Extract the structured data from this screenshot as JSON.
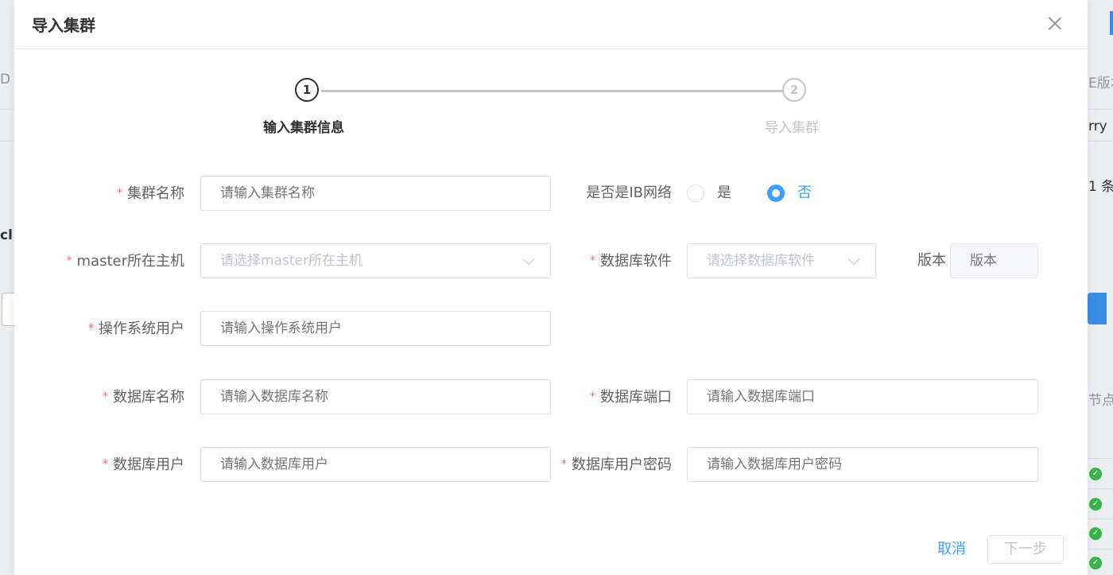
{
  "background": {
    "left_texts": [
      "D",
      "cl"
    ],
    "right_texts": [
      "E版本",
      "rry 1",
      "1 条",
      "节点数",
      "U",
      "U",
      "U",
      "U"
    ]
  },
  "modal": {
    "title": "导入集群",
    "steps": [
      {
        "number": "1",
        "title": "输入集群信息",
        "status": "active"
      },
      {
        "number": "2",
        "title": "导入集群",
        "status": "wait"
      }
    ],
    "form": {
      "required_mark": "*",
      "cluster_name": {
        "label": "集群名称",
        "placeholder": "请输入集群名称",
        "value": ""
      },
      "ib_network": {
        "label": "是否是IB网络",
        "options": [
          {
            "label": "是",
            "checked": false
          },
          {
            "label": "否",
            "checked": true
          }
        ]
      },
      "master_host": {
        "label": "master所在主机",
        "placeholder": "请选择master所在主机",
        "value": ""
      },
      "db_software": {
        "label": "数据库软件",
        "placeholder": "请选择数据库软件",
        "value": ""
      },
      "version": {
        "label": "版本",
        "placeholder": "版本",
        "value": ""
      },
      "os_user": {
        "label": "操作系统用户",
        "placeholder": "请输入操作系统用户",
        "value": ""
      },
      "db_name": {
        "label": "数据库名称",
        "placeholder": "请输入数据库名称",
        "value": ""
      },
      "db_port": {
        "label": "数据库端口",
        "placeholder": "请输入数据库端口",
        "value": ""
      },
      "db_user": {
        "label": "数据库用户",
        "placeholder": "请输入数据库用户",
        "value": ""
      },
      "db_password": {
        "label": "数据库用户密码",
        "placeholder": "请输入数据库用户密码",
        "value": ""
      }
    },
    "footer": {
      "cancel_label": "取消",
      "next_label": "下一步"
    }
  },
  "colors": {
    "primary": "#409eff",
    "required": "#f56c6c",
    "success": "#3bb34a",
    "placeholder": "#c0c4cc"
  }
}
